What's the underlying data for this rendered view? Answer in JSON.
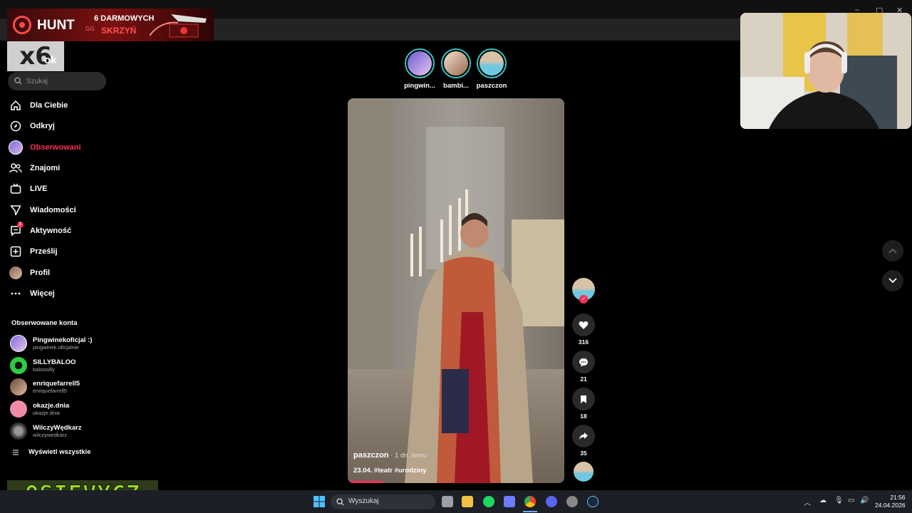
{
  "ad": {
    "brand": "HUNT",
    "brand_suffix": "GG",
    "line1": "6 DARMOWYCH",
    "line2": "SKRZYŃ",
    "multiplier": "x6"
  },
  "app": {
    "logo_tail": "ok"
  },
  "search": {
    "placeholder": "Szukaj"
  },
  "nav": [
    {
      "label": "Dla Ciebie",
      "icon": "home-icon"
    },
    {
      "label": "Odkryj",
      "icon": "compass-icon"
    },
    {
      "label": "Obserwowani",
      "icon": "following-avatar-icon",
      "active": true
    },
    {
      "label": "Znajomi",
      "icon": "friends-icon"
    },
    {
      "label": "LIVE",
      "icon": "live-tv-icon"
    },
    {
      "label": "Wiadomości",
      "icon": "send-icon"
    },
    {
      "label": "Aktywność",
      "icon": "activity-icon",
      "badge": "1"
    },
    {
      "label": "Prześlij",
      "icon": "upload-plus-icon"
    },
    {
      "label": "Profil",
      "icon": "profile-avatar-icon"
    },
    {
      "label": "Więcej",
      "icon": "more-dots-icon"
    }
  ],
  "following": {
    "heading": "Obserwowane konta",
    "accounts": [
      {
        "name": "Pingwinekoficjal :)",
        "handle": "pingwinek.oficjalnie"
      },
      {
        "name": "SILLYBALOO",
        "handle": "baloosilly"
      },
      {
        "name": "enriquefarrell5",
        "handle": "enriquefarrell5"
      },
      {
        "name": "okazje.dnia",
        "handle": "okazje.dnia"
      },
      {
        "name": "WilczyWędkarz",
        "handle": "wilczywedkarz"
      }
    ],
    "show_all": "Wyświetl wszystkie"
  },
  "stories": [
    {
      "name": "pingwin..."
    },
    {
      "name": "bambi..."
    },
    {
      "name": "paszczon"
    }
  ],
  "video": {
    "author": "paszczon",
    "time": " · 1 dn. temu",
    "description": "23.04. #teatr #urodziny",
    "progress": 0.16
  },
  "actions": {
    "likes": "316",
    "comments": "21",
    "saves": "18",
    "shares": "35"
  },
  "overlay_text": "OSIEVYCZ",
  "taskbar": {
    "search_label": "Wyszukaj",
    "time": "21:56",
    "date": "24.04.2026"
  },
  "colors": {
    "accent": "#fe2c55",
    "story_ring": "#33c3c0",
    "sidebar_bg": "#000000",
    "taskbar_bg": "#1c1f26"
  }
}
